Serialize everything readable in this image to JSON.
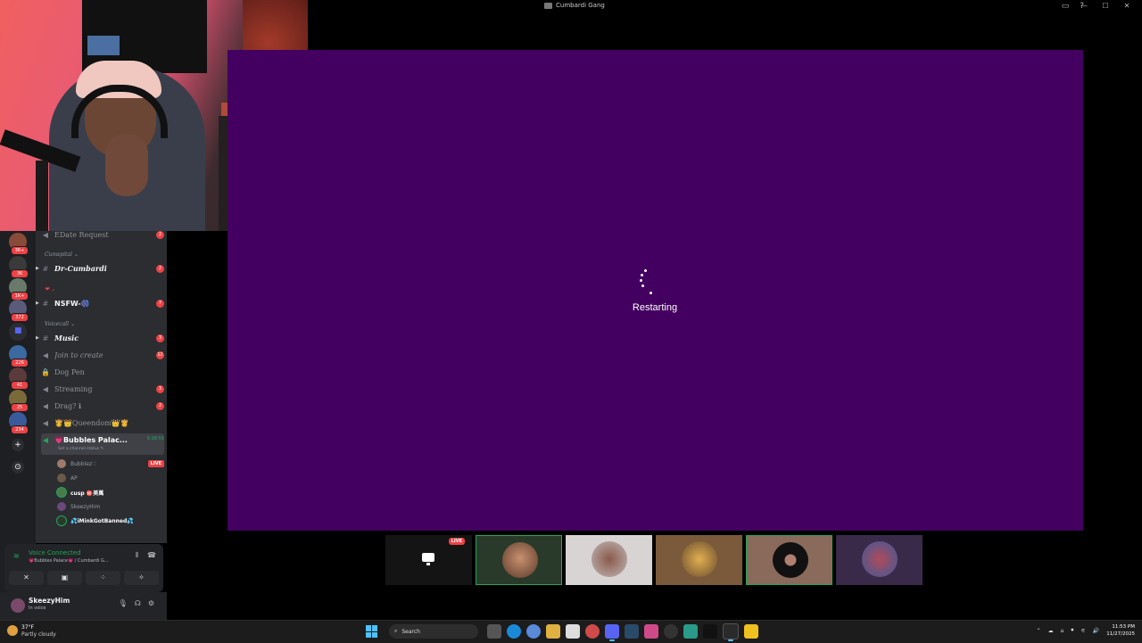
{
  "window": {
    "title": "Cumbardi Gang",
    "controls": [
      "—",
      "☐",
      "✕"
    ],
    "top_icons": [
      "inbox-icon",
      "help-icon"
    ]
  },
  "servers": [
    {
      "badge": "36+"
    },
    {
      "badge": "36"
    },
    {
      "badge": "1K+"
    },
    {
      "badge": "372"
    },
    {
      "badge": ""
    },
    {
      "badge": "226"
    },
    {
      "badge": "41"
    },
    {
      "badge": "25"
    },
    {
      "badge": "234"
    }
  ],
  "server_actions": {
    "add": "+",
    "discover": "⊙"
  },
  "channels": {
    "edate": {
      "name": "EDate Request",
      "count": "2"
    },
    "cat_cumspital": "Cumspital",
    "dr_cumbardi": {
      "name": "Dr-Cumbardi",
      "count": "2"
    },
    "cat_heart": "❤",
    "nsfw": {
      "name": "NSFW-🎆",
      "count": "7"
    },
    "cat_voicecall": "Voicecall",
    "music": {
      "name": "Music",
      "count": "3"
    },
    "join_to_create": {
      "name": "Join to create",
      "count": "12"
    },
    "dog_pen": {
      "name": "Dog Pen"
    },
    "streaming": {
      "name": "Streaming",
      "count": "3"
    },
    "drag": {
      "name": "Drag? ℹ",
      "count": "2"
    },
    "queendom": {
      "name": "👸👑Queendom👑👸"
    },
    "bubbles": {
      "name": "💗Bubbles Palac...",
      "timer": "6:08:56",
      "status": "Set a channel status ✎"
    }
  },
  "voice_users": [
    {
      "name": "Bubblez♡",
      "live": "LIVE"
    },
    {
      "name": "AP"
    },
    {
      "name": "cusp ㊙️美萬"
    },
    {
      "name": "SkeezyHim"
    },
    {
      "name": "💦iMinkGotBanned💦"
    }
  ],
  "voice_panel": {
    "status": "Voice Connected",
    "sub": "💗Bubbles Palace💗 / Cumbardi G...",
    "buttons": [
      "✕",
      "▣",
      "⁘",
      "✧"
    ]
  },
  "user_panel": {
    "name": "SkeezyHim",
    "status": "In voice"
  },
  "stage": {
    "message": "Restarting",
    "bg": "#430060"
  },
  "tiles": {
    "live": "LIVE"
  },
  "taskbar": {
    "temp": "37°F",
    "condition": "Partly cloudy",
    "search": "Search",
    "time": "11:53 PM",
    "date": "11/27/2025"
  }
}
